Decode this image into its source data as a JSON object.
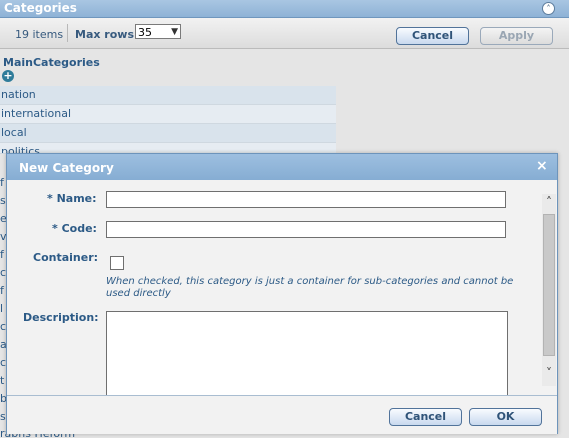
{
  "panel": {
    "title": "Categories",
    "collapse_glyph": "˄",
    "items_count": "19 items",
    "max_rows_label": "Max rows:",
    "max_rows_value": "35",
    "cancel_label": "Cancel",
    "apply_label": "Apply",
    "main_categories_label": "MainCategories",
    "add_glyph": "+",
    "rows": [
      "nation",
      "international",
      "local",
      "politics"
    ],
    "partial_letters": [
      "f",
      "s",
      "e",
      "v",
      "f",
      "c",
      "f",
      "l",
      "c",
      "a",
      "c",
      "t",
      "b",
      "s"
    ],
    "bottom_peek": "rabhs Heform"
  },
  "modal": {
    "title": "New Category",
    "close_glyph": "×",
    "name_label": "* Name:",
    "name_value": "",
    "code_label": "* Code:",
    "code_value": "",
    "container_label": "Container:",
    "container_help": "When checked, this category is just a container for sub-categories and cannot be used directly",
    "description_label": "Description:",
    "cancel_label": "Cancel",
    "ok_label": "OK",
    "scroll_up_glyph": "˄",
    "scroll_down_glyph": "˅"
  },
  "colors": {
    "header_blue": "#8eb2d6",
    "label_blue": "#2c5a86",
    "button_border": "#51739a"
  }
}
